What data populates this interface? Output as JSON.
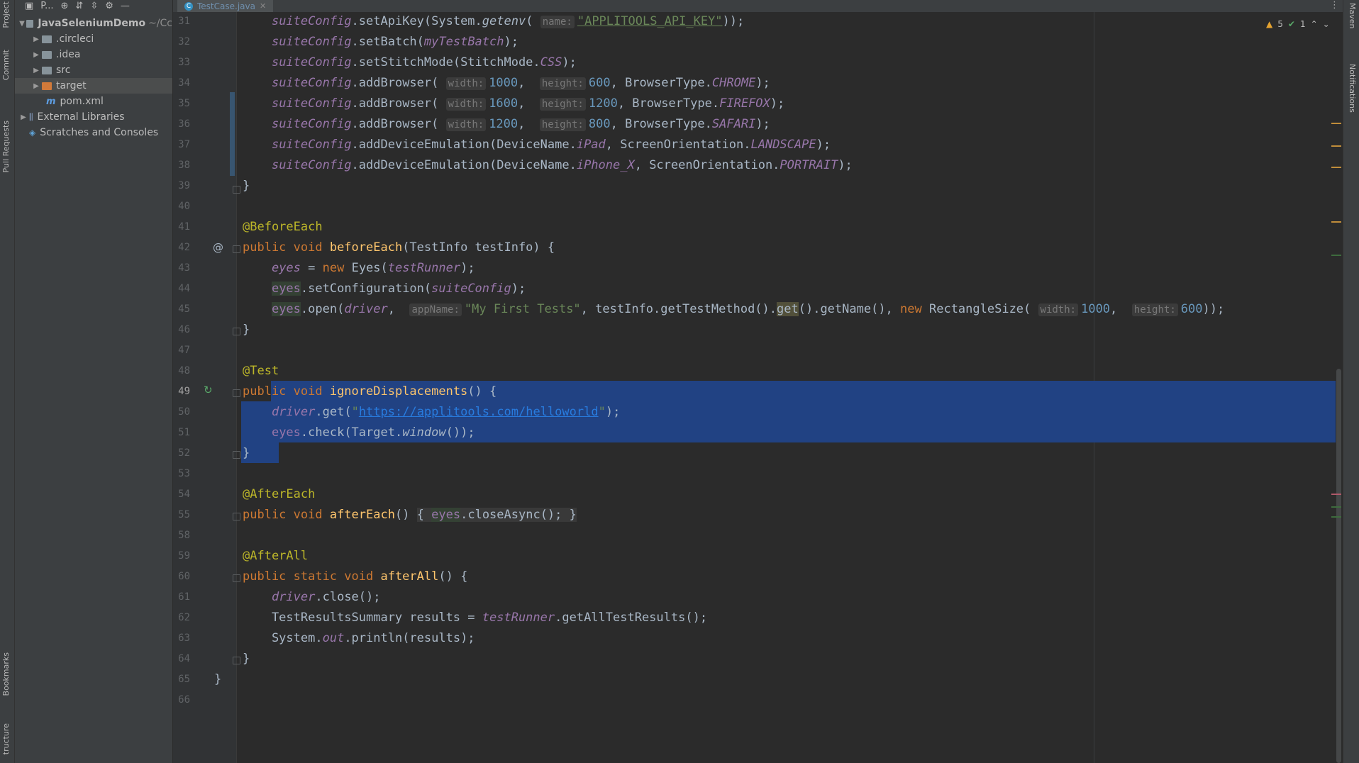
{
  "left_strip": {
    "project": "Project",
    "commit": "Commit",
    "pull_requests": "Pull Requests",
    "bookmarks": "Bookmarks",
    "structure": "tructure"
  },
  "right_strip": {
    "maven": "Maven",
    "notifications": "Notifications"
  },
  "project_panel": {
    "title": "P...",
    "tree": [
      {
        "label": "JavaSeleniumDemo",
        "suffix": "~/Cc",
        "kind": "module"
      },
      {
        "label": ".circleci",
        "kind": "folder"
      },
      {
        "label": ".idea",
        "kind": "folder"
      },
      {
        "label": "src",
        "kind": "folder"
      },
      {
        "label": "target",
        "kind": "folder-orange"
      },
      {
        "label": "pom.xml",
        "kind": "maven"
      },
      {
        "label": "External Libraries",
        "kind": "lib"
      },
      {
        "label": "Scratches and Consoles",
        "kind": "scratch"
      }
    ]
  },
  "editor": {
    "tab": "TestCase.java",
    "inspections": {
      "warnings": "5",
      "ok": "1"
    },
    "line_numbers": [
      "31",
      "32",
      "33",
      "34",
      "35",
      "36",
      "37",
      "38",
      "39",
      "40",
      "41",
      "42",
      "43",
      "44",
      "45",
      "46",
      "47",
      "48",
      "49",
      "50",
      "51",
      "52",
      "53",
      "54",
      "55",
      "58",
      "59",
      "60",
      "61",
      "62",
      "63",
      "64",
      "65",
      "66"
    ],
    "hint_name": "name:",
    "hint_width": "width:",
    "hint_height": "height:",
    "hint_appname": "appName:",
    "api_key_env": "\"APPLITOOLS_API_KEY\"",
    "browsers": [
      {
        "width": "1000",
        "height": "600",
        "type": "CHROME"
      },
      {
        "width": "1600",
        "height": "1200",
        "type": "FIREFOX"
      },
      {
        "width": "1200",
        "height": "800",
        "type": "SAFARI"
      }
    ],
    "devices": [
      {
        "device": "iPad",
        "orientation": "LANDSCAPE"
      },
      {
        "device": "iPhone_X",
        "orientation": "PORTRAIT"
      }
    ],
    "annotations": {
      "before_each": "@BeforeEach",
      "test": "@Test",
      "after_each": "@AfterEach",
      "after_all": "@AfterAll"
    },
    "method_names": {
      "before_each": "beforeEach",
      "ignore": "ignoreDisplacements",
      "after_each": "afterEach",
      "after_all": "afterAll"
    },
    "app_name": "\"My First Tests\"",
    "url": "https://applitools.com/helloworld",
    "rect": {
      "width": "1000",
      "height": "600"
    }
  }
}
